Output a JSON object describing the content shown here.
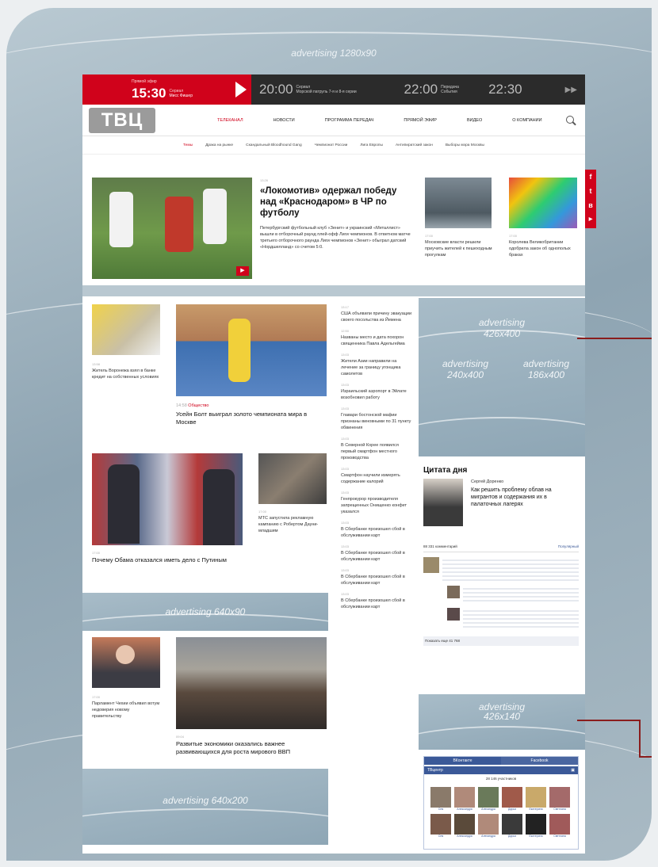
{
  "ads": {
    "top": "advertising 1280x90",
    "side_large": "advertising\n426x400",
    "side_a": "advertising\n240x400",
    "side_b": "advertising\n186x400",
    "mid": "advertising 640x90",
    "side_small": "advertising\n426x140",
    "bottom": "advertising 640x200"
  },
  "live": {
    "label": "Прямой эфир",
    "time": "15:30",
    "sub": "Сериал",
    "title": "Мисс Фишер",
    "schedule": [
      {
        "time": "20:00",
        "genre": "Сериал",
        "title": "Морской патруль 7-я и 8-я серии"
      },
      {
        "time": "22:00",
        "genre": "Передача",
        "title": "События"
      },
      {
        "time": "22:30",
        "genre": "",
        "title": ""
      }
    ]
  },
  "nav": {
    "logo": "ТВЦ",
    "items": [
      "Телеканал",
      "Новости",
      "Программа передач",
      "Прямой эфир",
      "Видео",
      "О компании"
    ]
  },
  "tags": [
    "Темы",
    "Драка на рынке",
    "Скандальный Bloodhound Gang",
    "Чемпионат России",
    "Лига Европы",
    "Антипиратский закон",
    "Выборы мэра Москвы"
  ],
  "lead": {
    "time": "13:26",
    "title": "«Локомотив» одержал победу над «Краснодаром» в ЧР по футболу",
    "text": "Петербургский футбольный клуб «Зенит» и украинский «Металлист» вышли в отборочный раунд плей-офф Лиги чемпионов. В ответном матче третьего отборочного раунда Лиги чемпионов «Зенит» обыграл датский «Нордшелланд» со счетом 5:0."
  },
  "side_news": [
    {
      "time": "17:00",
      "text": "Московские власти решили приучить жителей к пешеходным прогулкам"
    },
    {
      "time": "17:00",
      "text": "Королева Великобритании одобрила закон об однополых браках"
    }
  ],
  "news_col1": {
    "time": "13:58",
    "text": "Житель Воронежа взял в банке кредит на собственных условиях"
  },
  "bolt": {
    "time": "14:58",
    "tag": "Общество",
    "title": "Усейн Болт выиграл золото чемпионата мира в Москве"
  },
  "right_list": [
    {
      "time": "13:17",
      "text": "США объявили причину эвакуации своего посольства из Йемена"
    },
    {
      "time": "12:50",
      "text": "Названы место и дата похорон священника Павла Адельгейма"
    },
    {
      "time": "13:03",
      "text": "Жители Азии направили на лечение за границу угонщика самолетов"
    },
    {
      "time": "13:03",
      "text": "Израильский аэропорт в Эйлате возобновил работу"
    },
    {
      "time": "13:03",
      "text": "Главари бостонской мафии признаны виновными по 31 пункту обвинения"
    },
    {
      "time": "13:03",
      "text": "В Северной Корее появился первый смартфон местного производства"
    },
    {
      "time": "13:03",
      "text": "Смартфон научили измерять содержание калорий"
    },
    {
      "time": "13:03",
      "text": "Генпрокурор производителя запрещенных Онищенко конфет указался"
    },
    {
      "time": "13:03",
      "text": "В Сбербанке произошел сбой в обслуживании карт"
    },
    {
      "time": "13:03",
      "text": "В Сбербанке произошел сбой в обслуживании карт"
    },
    {
      "time": "13:03",
      "text": "В Сбербанке произошел сбой в обслуживании карт"
    },
    {
      "time": "13:03",
      "text": "В Сбербанке произошел сбой в обслуживании карт"
    }
  ],
  "obama": {
    "time": "17:00",
    "title": "Почему Обама отказался иметь дело с Путиным"
  },
  "mts": {
    "time": "17:00",
    "text": "МТС запустила рекламную кампанию с Робертом Дауни-младшим"
  },
  "quote": {
    "heading": "Цитата дня",
    "author": "Сергей Доренко",
    "text": "Как решить проблему облав на мигрантов и содержания их в палаточных лагерях"
  },
  "comments": {
    "count": "88 331 комментарий",
    "sort": "Популярный",
    "more": "Показать еще 41 768"
  },
  "czech": {
    "time": "17:00",
    "text": "Парламент Чехии объявил вотум недоверия новому правительству"
  },
  "economy": {
    "time": "09:04",
    "title": "Развитые экономики оказались важнее развивающихся для роста мирового ВВП"
  },
  "widget": {
    "tab1": "ВКонтакте",
    "tab2": "Facebook",
    "name": "ТВцентр",
    "members": "28 146 участников",
    "people": [
      "Оля",
      "Александра",
      "Алехандра",
      "Дарья",
      "Екатерина",
      "Светлана",
      "Оля",
      "Александра",
      "Алехандра",
      "Дарья",
      "Екатерина",
      "Светлана"
    ]
  },
  "social": [
    "f",
    "t",
    "в",
    "▶"
  ]
}
